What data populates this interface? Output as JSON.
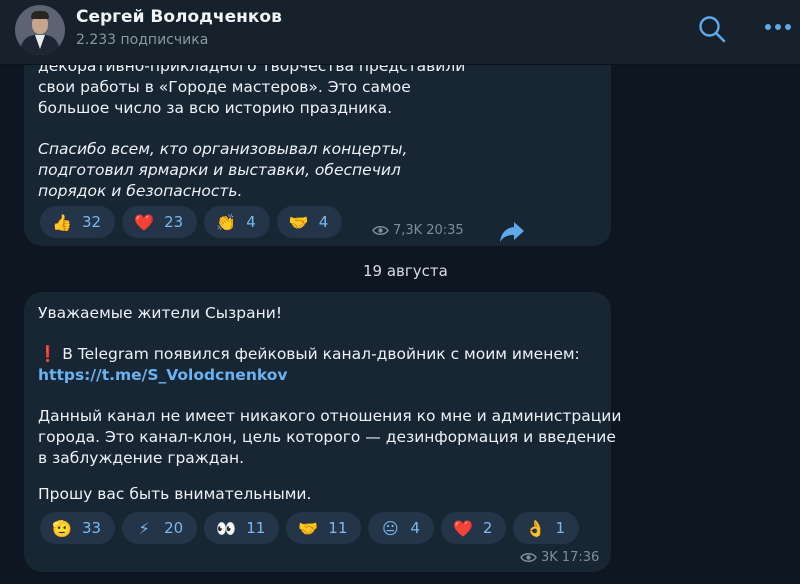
{
  "header": {
    "title": "Сергей Володченков",
    "subtitle": "2.233 подписчика",
    "icons": [
      "search-icon",
      "more-icon"
    ]
  },
  "message1": {
    "lines": [
      "декоративно-прикладного творчества представили",
      "свои работы в «Городе мастеров». Это самое",
      "большое число за всю историю праздника."
    ],
    "italic_lines": [
      "Спасибо всем, кто организовывал концерты,",
      "подготовил ярмарки и выставки, обеспечил",
      "порядок и безопасность."
    ],
    "reactions": [
      {
        "emoji": "👍",
        "count": "32"
      },
      {
        "emoji": "❤️",
        "count": "23"
      },
      {
        "emoji": "👏",
        "count": "4"
      },
      {
        "emoji": "🤝",
        "count": "4"
      }
    ],
    "views": "7,3K",
    "time": "20:35"
  },
  "date_separator": "19 августа",
  "message2": {
    "greeting": "Уважаемые жители Сызрани!",
    "alert_emoji": "❗",
    "alert_text": "В Telegram появился фейковый канал-двойник с моим именем:",
    "link": "https://t.me/S_Volodcnenkov",
    "para_lines": [
      "Данный канал не имеет никакого отношения ко мне и администрации",
      "города. Это канал-клон, цель которого — дезинформация и введение",
      "в заблуждение граждан."
    ],
    "closing": "Прошу вас быть внимательными.",
    "reactions": [
      {
        "emoji": "🫡",
        "count": "33"
      },
      {
        "emoji": "⚡",
        "count": "20"
      },
      {
        "emoji": "👀",
        "count": "11"
      },
      {
        "emoji": "🤝",
        "count": "11"
      },
      {
        "emoji": "😐",
        "count": "4"
      },
      {
        "emoji": "❤️",
        "count": "2"
      },
      {
        "emoji": "👌",
        "count": "1"
      }
    ],
    "views": "3K",
    "time": "17:36"
  },
  "colors": {
    "background": "#0e1621",
    "bubble": "#182533",
    "accent": "#6ab3f3",
    "reaction_chip": "#253549"
  }
}
